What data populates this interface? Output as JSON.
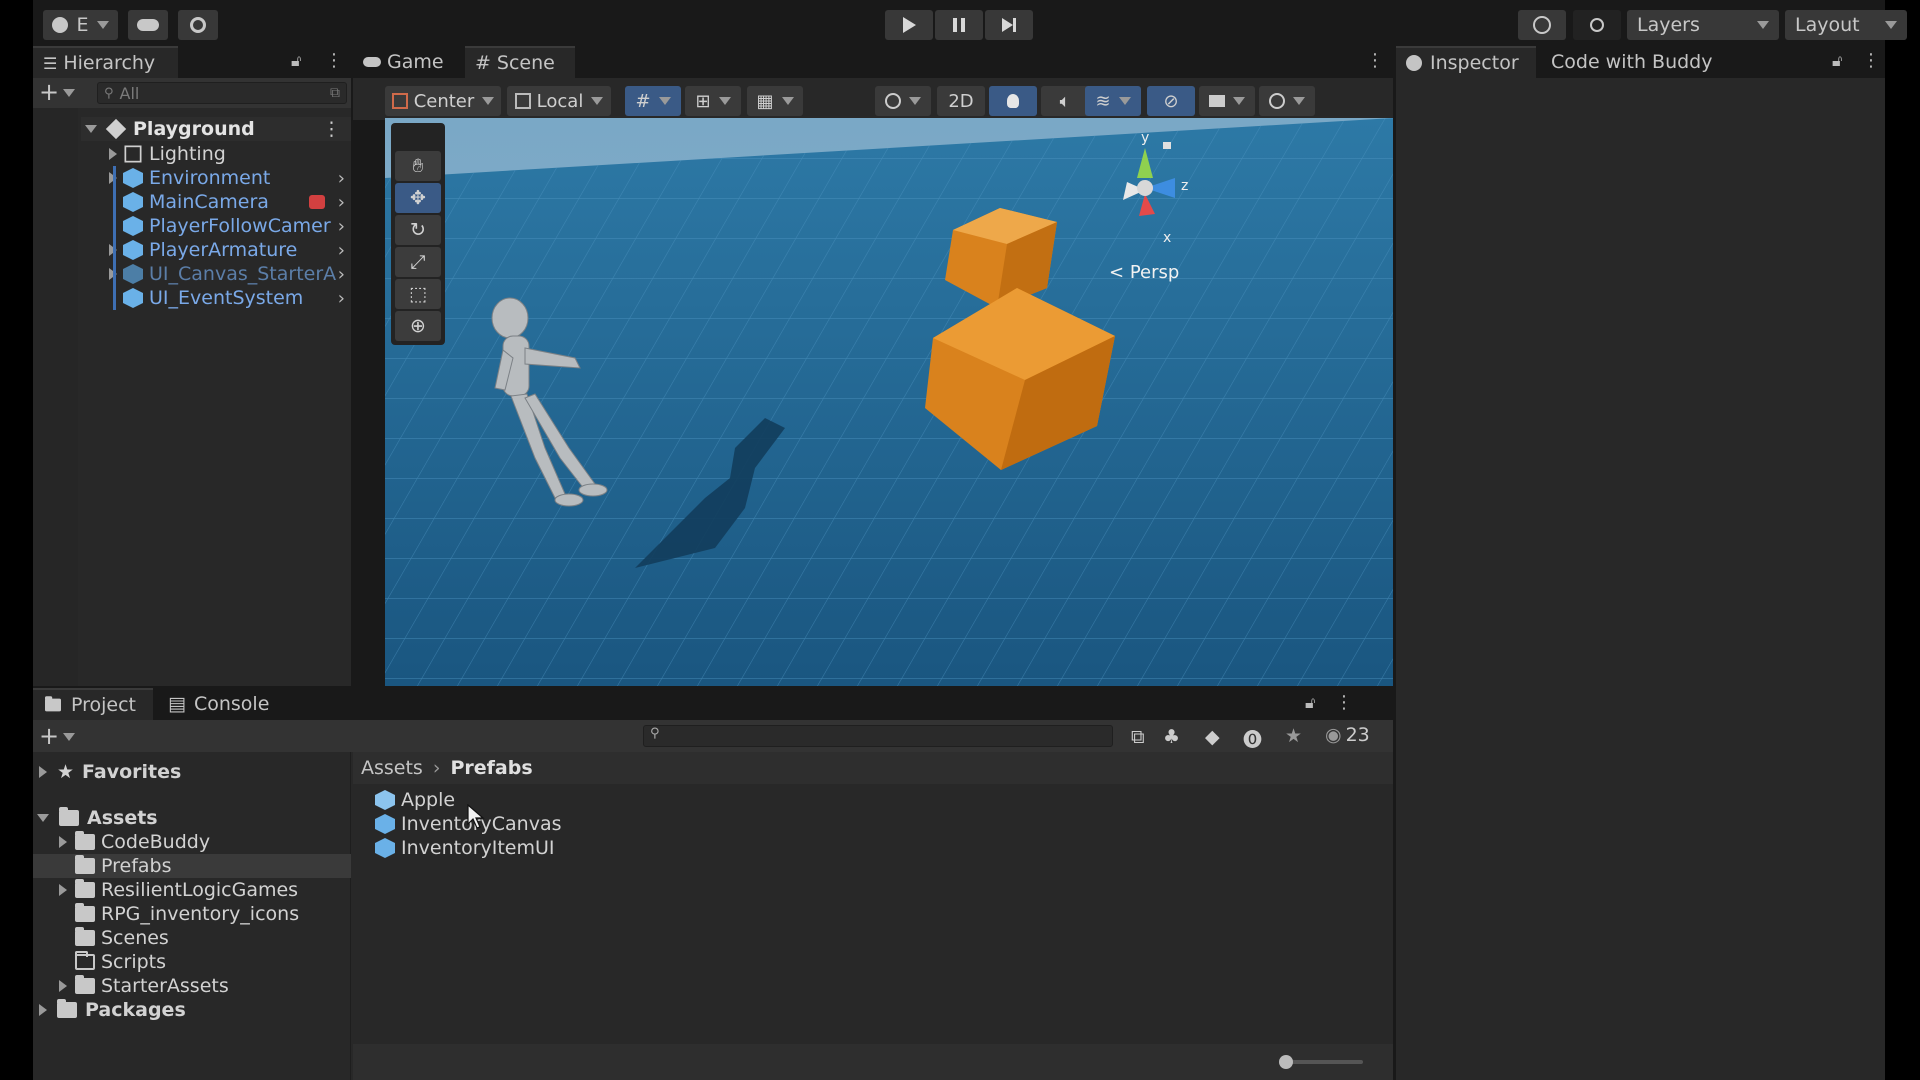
{
  "toolbar": {
    "account_label": "E",
    "layers_label": "Layers",
    "layout_label": "Layout"
  },
  "hierarchy": {
    "tab_label": "Hierarchy",
    "search_placeholder": "All",
    "scene_name": "Playground",
    "items": [
      {
        "label": "Lighting"
      },
      {
        "label": "Environment"
      },
      {
        "label": "MainCamera"
      },
      {
        "label": "PlayerFollowCamer"
      },
      {
        "label": "PlayerArmature"
      },
      {
        "label": "UI_Canvas_StarterA"
      },
      {
        "label": "UI_EventSystem"
      }
    ]
  },
  "center_tabs": {
    "game": "Game",
    "scene": "Scene"
  },
  "scene_toolbar": {
    "pivot": "Center",
    "space": "Local",
    "mode_2d": "2D"
  },
  "gizmo": {
    "persp": "Persp",
    "x": "x",
    "y": "y",
    "z": "z"
  },
  "right_tabs": {
    "inspector": "Inspector",
    "buddy": "Code with Buddy"
  },
  "bottom_tabs": {
    "project": "Project",
    "console": "Console"
  },
  "project": {
    "favorites": "Favorites",
    "assets": "Assets",
    "folders": [
      {
        "label": "CodeBuddy"
      },
      {
        "label": "Prefabs"
      },
      {
        "label": "ResilientLogicGames"
      },
      {
        "label": "RPG_inventory_icons"
      },
      {
        "label": "Scenes"
      },
      {
        "label": "Scripts"
      },
      {
        "label": "StarterAssets"
      }
    ],
    "packages": "Packages",
    "breadcrumb": {
      "root": "Assets",
      "current": "Prefabs"
    },
    "files": [
      {
        "label": "Apple"
      },
      {
        "label": "InventoryCanvas"
      },
      {
        "label": "InventoryItemUI"
      }
    ],
    "hidden_count": "23"
  },
  "colors": {
    "accent": "#3a5a86",
    "link_blue": "#7aa9e8",
    "cube_orange": "#d9821d",
    "floor_blue": "#1f5e86"
  }
}
